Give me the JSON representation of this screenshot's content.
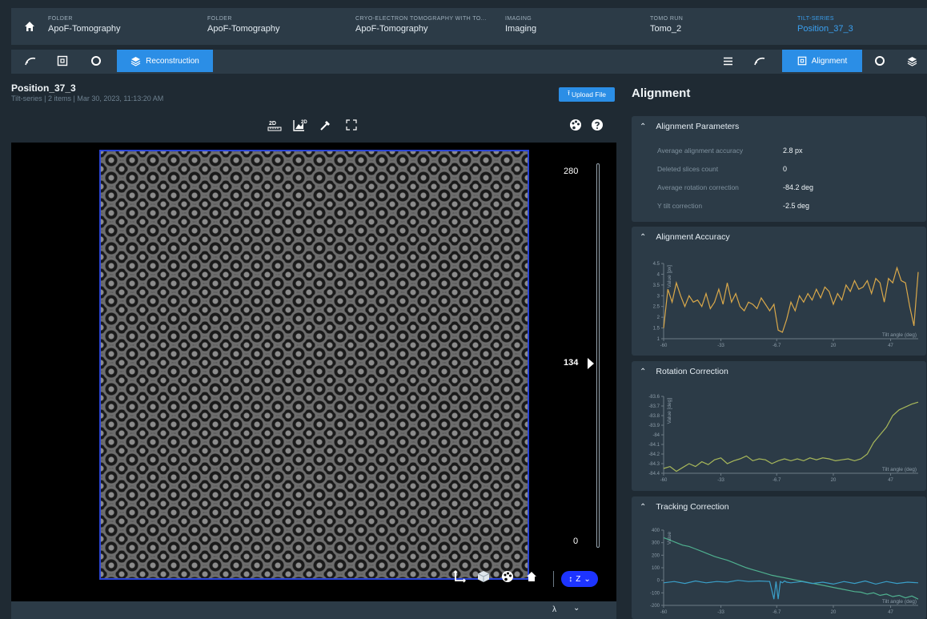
{
  "breadcrumbs": [
    {
      "key": "FOLDER",
      "value": "ApoF-Tomography"
    },
    {
      "key": "FOLDER",
      "value": "ApoF-Tomography"
    },
    {
      "key": "CRYO-ELECTRON TOMOGRAPHY WITH TO...",
      "value": "ApoF-Tomography"
    },
    {
      "key": "IMAGING",
      "value": "Imaging"
    },
    {
      "key": "TOMO RUN",
      "value": "Tomo_2"
    },
    {
      "key": "TILT-SERIES",
      "value": "Position_37_3"
    }
  ],
  "toolbar": {
    "left_active_label": "Reconstruction",
    "right_active_label": "Alignment"
  },
  "item": {
    "title": "Position_37_3",
    "subtitle": "Tilt-series  |  2 items  |  Mar 30, 2023, 11:13:20 AM",
    "upload_label": "Upload File"
  },
  "viewer": {
    "scale_top": "280",
    "scale_current": "134",
    "scale_bottom": "0",
    "current_slice_fraction": 0.479,
    "axis_label": "Z",
    "tool_2d_a": "2D",
    "tool_2d_b": "2D"
  },
  "footer": {
    "char": "λ"
  },
  "right": {
    "title": "Alignment",
    "params_header": "Alignment Parameters",
    "params": [
      {
        "label": "Average alignment accuracy",
        "value": "2.8 px"
      },
      {
        "label": "Deleted slices count",
        "value": "0"
      },
      {
        "label": "Average rotation correction",
        "value": "-84.2 deg"
      },
      {
        "label": "Y tilt correction",
        "value": "-2.5 deg"
      }
    ],
    "acc_header": "Alignment Accuracy",
    "rot_header": "Rotation Correction",
    "track_header": "Tracking Correction"
  },
  "chart_data": [
    {
      "type": "line",
      "title": "Alignment Accuracy",
      "xlabel": "Tilt angle (deg)",
      "ylabel": "Value [px]",
      "xlim": [
        -60,
        60
      ],
      "ylim": [
        1,
        4.5
      ],
      "xticks": [
        "-60",
        "-33",
        "-6.7",
        "20",
        "47"
      ],
      "yticks": [
        "1",
        "1.5",
        "2",
        "2.5",
        "3",
        "3.5",
        "4",
        "4.5"
      ],
      "series": [
        {
          "color": "#d9a84a",
          "x": [
            -60,
            -58,
            -56,
            -54,
            -52,
            -50,
            -48,
            -46,
            -44,
            -42,
            -40,
            -38,
            -36,
            -34,
            -32,
            -30,
            -28,
            -26,
            -24,
            -22,
            -20,
            -18,
            -16,
            -14,
            -12,
            -10,
            -8,
            -6,
            -4,
            -2,
            0,
            2,
            4,
            6,
            8,
            10,
            12,
            14,
            16,
            18,
            20,
            22,
            24,
            26,
            28,
            30,
            32,
            34,
            36,
            38,
            40,
            42,
            44,
            46,
            48,
            50,
            52,
            54,
            56,
            58,
            60
          ],
          "values": [
            1.5,
            3.3,
            2.7,
            3.6,
            3.0,
            2.5,
            3.0,
            2.7,
            2.8,
            2.5,
            3.1,
            2.4,
            2.7,
            3.3,
            2.6,
            3.6,
            2.7,
            3.1,
            2.5,
            2.3,
            2.7,
            2.6,
            2.4,
            2.9,
            2.6,
            2.3,
            2.6,
            1.4,
            1.3,
            1.9,
            2.7,
            2.3,
            3.0,
            2.7,
            3.1,
            2.8,
            3.3,
            2.9,
            3.4,
            3.2,
            2.6,
            3.1,
            2.8,
            3.5,
            3.2,
            3.7,
            3.3,
            3.4,
            3.7,
            3.1,
            3.8,
            3.6,
            2.7,
            3.8,
            3.6,
            4.3,
            3.7,
            3.6,
            2.5,
            1.6,
            4.1
          ]
        }
      ]
    },
    {
      "type": "line",
      "title": "Rotation Correction",
      "xlabel": "Tilt angle (deg)",
      "ylabel": "Value [deg]",
      "xlim": [
        -60,
        60
      ],
      "ylim": [
        -84.4,
        -83.6
      ],
      "xticks": [
        "-60",
        "-33",
        "-6.7",
        "20",
        "47"
      ],
      "yticks": [
        "-83.6",
        "-83.7",
        "-83.8",
        "-83.9",
        "-84",
        "-84.1",
        "-84.2",
        "-84.3",
        "-84.4"
      ],
      "series": [
        {
          "color": "#a8b85a",
          "x": [
            -60,
            -57,
            -54,
            -51,
            -48,
            -45,
            -42,
            -39,
            -36,
            -33,
            -30,
            -27,
            -24,
            -21,
            -18,
            -15,
            -12,
            -9,
            -6,
            -3,
            0,
            3,
            6,
            9,
            12,
            15,
            18,
            21,
            24,
            27,
            30,
            33,
            36,
            39,
            42,
            45,
            48,
            51,
            54,
            57,
            60
          ],
          "values": [
            -84.35,
            -84.33,
            -84.38,
            -84.34,
            -84.3,
            -84.33,
            -84.28,
            -84.31,
            -84.26,
            -84.24,
            -84.3,
            -84.27,
            -84.25,
            -84.22,
            -84.27,
            -84.25,
            -84.26,
            -84.3,
            -84.27,
            -84.25,
            -84.27,
            -84.25,
            -84.27,
            -84.24,
            -84.26,
            -84.24,
            -84.25,
            -84.27,
            -84.26,
            -84.25,
            -84.27,
            -84.25,
            -84.2,
            -84.08,
            -84.0,
            -83.92,
            -83.8,
            -83.74,
            -83.71,
            -83.68,
            -83.66
          ]
        }
      ]
    },
    {
      "type": "line",
      "title": "Tracking Correction",
      "xlabel": "Tilt angle (deg)",
      "ylabel": "Value",
      "xlim": [
        -60,
        60
      ],
      "ylim": [
        -200,
        400
      ],
      "xticks": [
        "-60",
        "-33",
        "-6.7",
        "20",
        "47"
      ],
      "yticks": [
        "400",
        "300",
        "200",
        "100",
        "0",
        "-100",
        "-200"
      ],
      "series": [
        {
          "color": "#4fb08f",
          "x": [
            -60,
            -57,
            -54,
            -51,
            -48,
            -45,
            -42,
            -39,
            -36,
            -33,
            -30,
            -27,
            -24,
            -21,
            -18,
            -15,
            -12,
            -9,
            -6,
            -3,
            0,
            3,
            6,
            9,
            12,
            15,
            18,
            21,
            24,
            27,
            30,
            33,
            36,
            39,
            42,
            45,
            48,
            51,
            54,
            57,
            60
          ],
          "values": [
            340,
            320,
            300,
            280,
            270,
            250,
            230,
            210,
            190,
            175,
            160,
            140,
            120,
            100,
            85,
            70,
            55,
            40,
            30,
            20,
            10,
            0,
            -10,
            -20,
            -30,
            -40,
            -50,
            -60,
            -70,
            -80,
            -90,
            -95,
            -110,
            -100,
            -120,
            -110,
            -130,
            -120,
            -140,
            -125,
            -150
          ]
        },
        {
          "color": "#3a9fc8",
          "x": [
            -60,
            -55,
            -50,
            -45,
            -40,
            -35,
            -30,
            -25,
            -20,
            -15,
            -10,
            -8,
            -7,
            -6,
            -5,
            -4,
            -3,
            -2,
            0,
            5,
            10,
            15,
            20,
            25,
            30,
            35,
            40,
            45,
            50,
            55,
            60
          ],
          "values": [
            -20,
            -10,
            -25,
            -5,
            -20,
            -10,
            -15,
            0,
            -10,
            -5,
            -10,
            -150,
            -10,
            -150,
            -10,
            -20,
            -5,
            -15,
            -20,
            -10,
            -25,
            -15,
            -30,
            -10,
            -25,
            -5,
            -30,
            -10,
            -25,
            -15,
            -20
          ]
        }
      ]
    }
  ]
}
